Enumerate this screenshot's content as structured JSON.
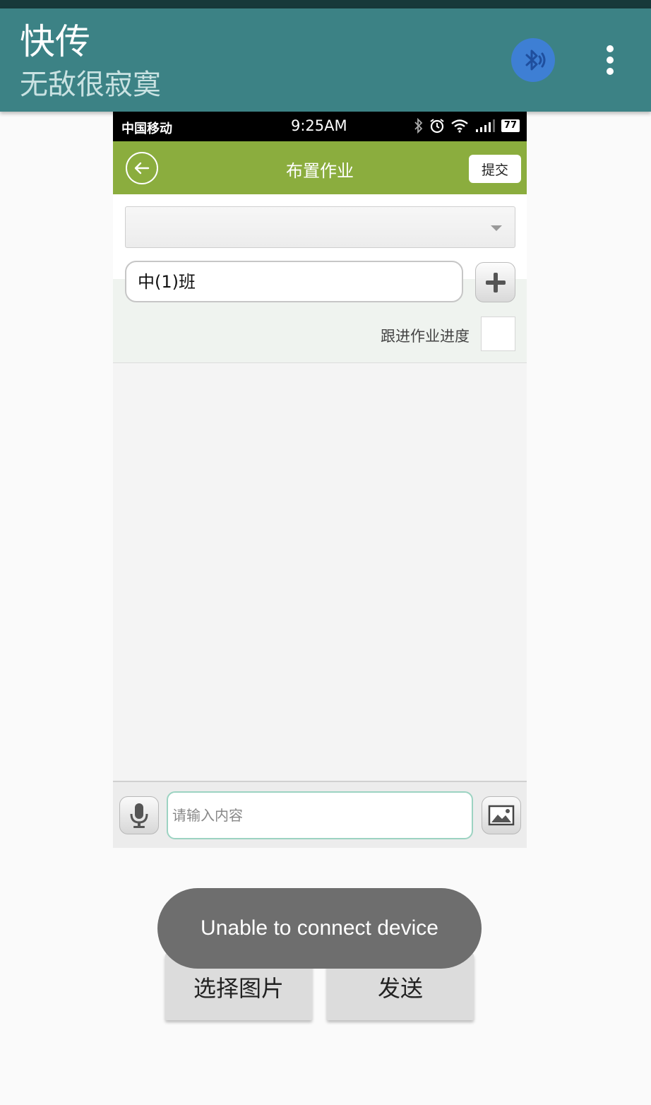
{
  "app_bar": {
    "title": "快传",
    "subtitle": "无敌很寂寞",
    "bluetooth_icon": "bluetooth-audio-icon",
    "more_icon": "more-vertical-icon"
  },
  "screenshot": {
    "status_bar": {
      "carrier": "中国移动",
      "time": "9:25AM",
      "battery": "77",
      "icons": [
        "bluetooth-icon",
        "alarm-icon",
        "wifi-icon",
        "signal-icon",
        "battery-icon"
      ]
    },
    "header": {
      "title": "布置作业",
      "submit_label": "提交",
      "back_icon": "back-arrow-icon"
    },
    "form": {
      "dropdown_value": "",
      "class_value": "中(1)班",
      "follow_label": "跟进作业进度",
      "add_icon": "plus-icon"
    },
    "composer": {
      "placeholder": "请输入内容",
      "mic_icon": "microphone-icon",
      "image_icon": "image-icon"
    }
  },
  "buttons": {
    "choose_image": "选择图片",
    "send": "发送"
  },
  "toast": {
    "message": "Unable to connect device"
  },
  "colors": {
    "app_bar": "#3c8285",
    "screenshot_header": "#8bad3e",
    "bluetooth_button": "#3e7fd4",
    "toast": "#6e6e6e"
  }
}
